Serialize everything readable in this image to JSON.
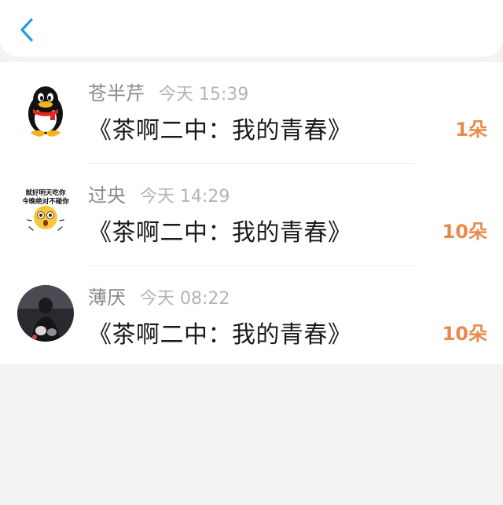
{
  "header": {
    "back_icon": "chevron-left-icon",
    "accent": "#1e9ee6"
  },
  "items": [
    {
      "name": "苍半芹",
      "time": "今天 15:39",
      "title": "《茶啊二中：我的青春》",
      "count": "1朵",
      "avatar": "penguin-avatar"
    },
    {
      "name": "过央",
      "time": "今天 14:29",
      "title": "《茶啊二中：我的青春》",
      "count": "10朵",
      "avatar": "emoji-avatar",
      "avatar_caption": [
        "就好明天吃你",
        "今晚绝对不碰你"
      ]
    },
    {
      "name": "薄厌",
      "time": "今天 08:22",
      "title": "《茶啊二中：我的青春》",
      "count": "10朵",
      "avatar": "photo-avatar"
    }
  ],
  "colors": {
    "count": "#e98a4b",
    "name": "#8a8a8a",
    "time": "#b3b3b3"
  }
}
